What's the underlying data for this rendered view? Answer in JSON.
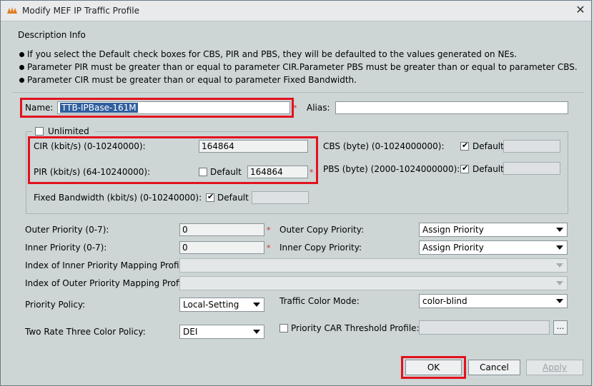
{
  "window": {
    "title": "Modify MEF IP Traffic Profile",
    "close_glyph": "✕"
  },
  "description": {
    "heading": "Description Info",
    "lines": [
      "If you select the Default check boxes for CBS, PIR and PBS, they will be defaulted to the values generated on NEs.",
      "Parameter PIR must be greater than or equal to parameter CIR.Parameter PBS must be greater than or equal to parameter CBS.",
      "Parameter CIR must be greater than or equal to parameter Fixed Bandwidth."
    ]
  },
  "name": {
    "label": "Name:",
    "value": "TTB-IPBase-161M"
  },
  "alias": {
    "label": "Alias:",
    "value": ""
  },
  "unlimited": {
    "label": "Unlimited",
    "checked": false
  },
  "cir": {
    "label": "CIR (kbit/s) (0-10240000):",
    "value": "164864"
  },
  "pir": {
    "label": "PIR (kbit/s) (64-10240000):",
    "default_label": "Default",
    "default_checked": false,
    "value": "164864"
  },
  "fixed_bw": {
    "label": "Fixed Bandwidth (kbit/s) (0-10240000):",
    "default_label": "Default",
    "default_checked": true,
    "value": ""
  },
  "cbs": {
    "label": "CBS (byte) (0-1024000000):",
    "default_label": "Default",
    "default_checked": true,
    "value": ""
  },
  "pbs": {
    "label": "PBS (byte) (2000-1024000000):",
    "default_label": "Default",
    "default_checked": true,
    "value": ""
  },
  "outer_priority": {
    "label": "Outer Priority (0-7):",
    "value": "0"
  },
  "inner_priority": {
    "label": "Inner Priority (0-7):",
    "value": "0"
  },
  "outer_copy_priority": {
    "label": "Outer Copy Priority:",
    "value": "Assign Priority"
  },
  "inner_copy_priority": {
    "label": "Inner Copy Priority:",
    "value": "Assign Priority"
  },
  "inner_map_profile": {
    "label": "Index of Inner Priority Mapping Profile:",
    "value": ""
  },
  "outer_map_profile": {
    "label": "Index of Outer Priority Mapping Profile:",
    "value": ""
  },
  "priority_policy": {
    "label": "Priority Policy:",
    "value": "Local-Setting"
  },
  "traffic_color_mode": {
    "label": "Traffic Color Mode:",
    "value": "color-blind"
  },
  "two_rate_policy": {
    "label": "Two Rate Three Color Policy:",
    "value": "DEI"
  },
  "car_threshold": {
    "label": "Priority CAR Threshold Profile:",
    "checked": false,
    "value": "",
    "browse_label": "..."
  },
  "buttons": {
    "ok": "OK",
    "cancel": "Cancel",
    "apply": "Apply"
  },
  "colors": {
    "dialog_bg": "#cdd5d5",
    "highlight_red": "#e3111e",
    "selection_blue": "#2f5f9e"
  }
}
